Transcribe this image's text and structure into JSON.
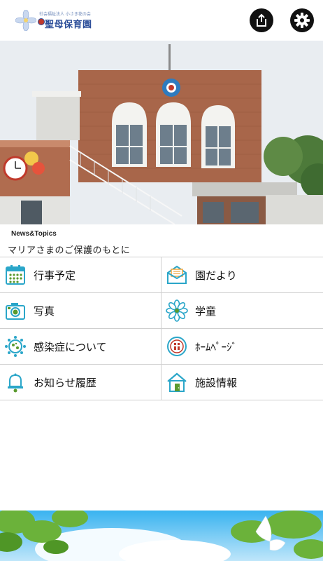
{
  "header": {
    "logo_subtitle": "社会福祉法人 小さき花の会",
    "logo_name": "聖母保育園",
    "share_icon": "share-icon",
    "settings_icon": "gear-icon"
  },
  "news": {
    "label": "News&Topics",
    "text": "マリアさまのご保護のもとに"
  },
  "menu": [
    {
      "label": "行事予定",
      "icon": "calendar-icon"
    },
    {
      "label": "園だより",
      "icon": "mail-icon"
    },
    {
      "label": "写真",
      "icon": "camera-icon"
    },
    {
      "label": "学童",
      "icon": "flower-icon"
    },
    {
      "label": "感染症について",
      "icon": "virus-icon"
    },
    {
      "label": "ﾎｰﾑﾍﾟｰｼﾞ",
      "icon": "homepage-icon"
    },
    {
      "label": "お知らせ履歴",
      "icon": "bell-icon"
    },
    {
      "label": "施設情報",
      "icon": "house-icon"
    }
  ],
  "colors": {
    "accent": "#2aa6c9",
    "brick": "#a9674a",
    "sky": "#e7ecf1"
  }
}
